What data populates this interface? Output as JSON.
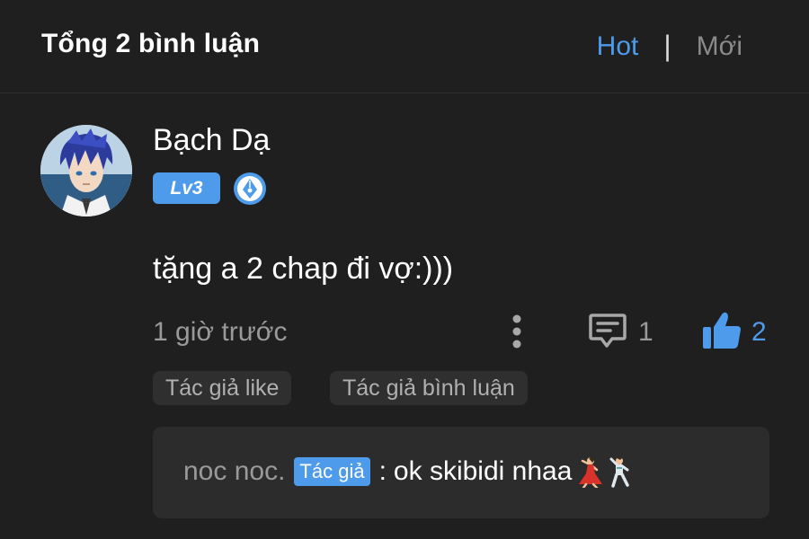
{
  "header": {
    "title": "Tổng 2 bình luận",
    "tabs": {
      "hot": "Hot",
      "separator": "|",
      "new": "Mới"
    },
    "active_tab": "hot"
  },
  "comment": {
    "avatar_icon": "avatar-anime-boy",
    "username": "Bạch Dạ",
    "level": "Lv3",
    "pen_badge_icon": "pen-nib-badge-icon",
    "text": "tặng a 2 chap đi vợ:)))",
    "time": "1 giờ trước",
    "more_icon": "more-vertical-icon",
    "reply_icon": "comment-icon",
    "reply_count": "1",
    "like_icon": "thumbs-up-icon",
    "like_count": "2",
    "tags": [
      "Tác giả like",
      "Tác giả bình luận"
    ]
  },
  "reply": {
    "username": "noc noc.",
    "badge": "Tác giả",
    "separator": ":",
    "text": "ok skibidi nhaa",
    "emojis": [
      "dancing-woman-emoji",
      "dancing-man-emoji"
    ]
  },
  "colors": {
    "background": "#1f1f1f",
    "accent": "#4d9bea",
    "muted_text": "#9a9a9a",
    "tag_bg": "#2f2f2f",
    "reply_bg": "#2c2c2c"
  }
}
